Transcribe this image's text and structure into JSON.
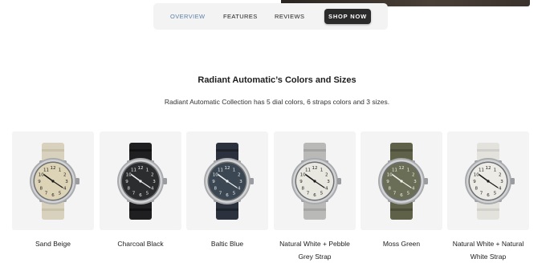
{
  "nav": {
    "overview": "OVERVIEW",
    "features": "FEATURES",
    "reviews": "REVIEWS",
    "shop_now": "SHOP NOW"
  },
  "section": {
    "title": "Radiant Automatic’s Colors and Sizes",
    "subtitle": "Radiant Automatic Collection has 5 dial colors, 6 straps colors and 3 sizes."
  },
  "products": [
    {
      "label": "Sand Beige",
      "dial": "#ddd3b6",
      "strap": "#d8d1bd",
      "strap_dark": "#c9c1aa",
      "numeral": "#1a1a1a"
    },
    {
      "label": "Charcoal Black",
      "dial": "#2c2d2f",
      "strap": "#1f1f21",
      "strap_dark": "#121213",
      "numeral": "#f0f0f0"
    },
    {
      "label": "Baltic Blue",
      "dial": "#3b4752",
      "strap": "#2b313d",
      "strap_dark": "#1d222b",
      "numeral": "#eef0f2"
    },
    {
      "label": "Natural White + Pebble Grey Strap",
      "dial": "#e8e7e0",
      "strap": "#b9b9b8",
      "strap_dark": "#a4a4a3",
      "numeral": "#1a1a1a"
    },
    {
      "label": "Moss Green",
      "dial": "#6a6e57",
      "strap": "#5f6149",
      "strap_dark": "#4c4e3a",
      "numeral": "#f2f2ea"
    },
    {
      "label": "Natural White + Natural White Strap",
      "dial": "#ecebe6",
      "strap": "#e3e2dd",
      "strap_dark": "#d1d0ca",
      "numeral": "#1a1a1a"
    }
  ]
}
